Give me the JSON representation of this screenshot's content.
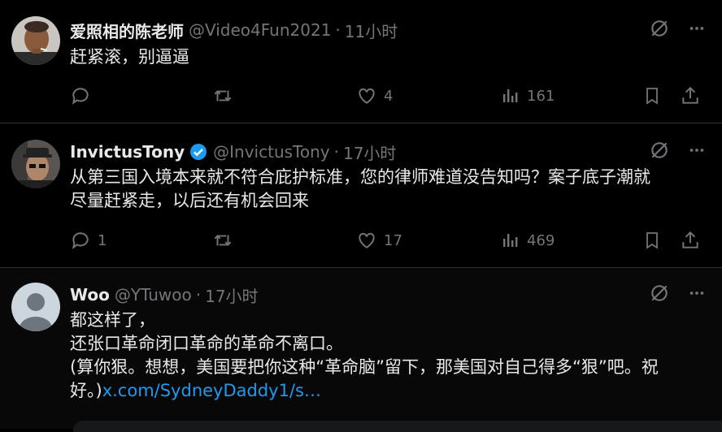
{
  "posts": [
    {
      "name": "爱照相的陈老师",
      "handle": "@Video4Fun2021",
      "time": "11小时",
      "verified": false,
      "text": "赶紧滚，别逼逼",
      "link": "",
      "replies": "",
      "reposts": "",
      "likes": "4",
      "views": "161"
    },
    {
      "name": "InvictusTony",
      "handle": "@InvictusTony",
      "time": "17小时",
      "verified": true,
      "text": "从第三国入境本来就不符合庇护标准，您的律师难道没告知吗？案子底子潮就\n尽量赶紧走，以后还有机会回来",
      "link": "",
      "replies": "1",
      "reposts": "",
      "likes": "17",
      "views": "469"
    },
    {
      "name": "Woo",
      "handle": "@YTuwoo",
      "time": "17小时",
      "verified": false,
      "text": "都这样了，\n还张口革命闭口革命的革命不离口。\n(算你狠。想想，美国要把你这种“革命脑”留下，那美国对自己得多“狠”吧。祝\n好。)",
      "link": "x.com/SydneyDaddy1/s…"
    }
  ],
  "colors": {
    "background": "#000000",
    "text": "#e7e9ea",
    "muted": "#71767b",
    "link": "#1d9bf0",
    "verified": "#1d9bf0",
    "divider": "#2f3336"
  },
  "icons": [
    "grok-icon",
    "more-icon",
    "reply-icon",
    "repost-icon",
    "like-icon",
    "views-icon",
    "bookmark-icon",
    "share-icon",
    "verified-badge-icon",
    "default-avatar-icon"
  ]
}
